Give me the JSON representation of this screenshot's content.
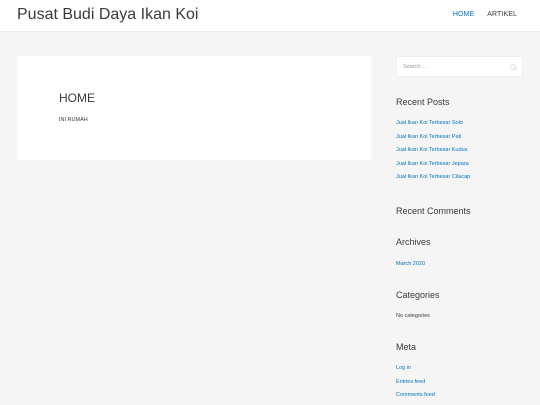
{
  "header": {
    "site_title": "Pusat Budi Daya Ikan Koi",
    "nav": [
      {
        "label": "HOME",
        "active": true
      },
      {
        "label": "ARTIKEL",
        "active": false
      }
    ]
  },
  "article": {
    "title": "HOME",
    "body": "INI RUMAH"
  },
  "sidebar": {
    "search": {
      "placeholder": "Search …",
      "icon": "search-icon"
    },
    "recent_posts": {
      "title": "Recent Posts",
      "items": [
        "Jual Ikan Koi Terbesar Solo",
        "Jual Ikan Koi Terbesar Pati",
        "Jual Ikan Koi Terbesar Kudus",
        "Jual Ikan Koi Terbesar Jepara",
        "Jual Ikan Koi Terbesar Cilacap"
      ]
    },
    "recent_comments": {
      "title": "Recent Comments"
    },
    "archives": {
      "title": "Archives",
      "items": [
        "March 2020"
      ]
    },
    "categories": {
      "title": "Categories",
      "empty_text": "No categories"
    },
    "meta": {
      "title": "Meta",
      "items": [
        "Log in",
        "Entries feed",
        "Comments feed"
      ]
    }
  },
  "colors": {
    "accent": "#0274be",
    "text": "#3a3a3a",
    "background": "#f5f5f5"
  }
}
